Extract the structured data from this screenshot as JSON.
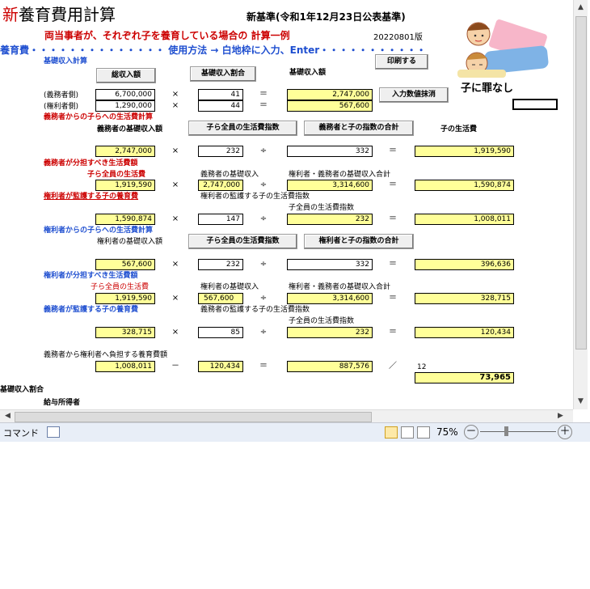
{
  "title": {
    "new": "新",
    "rest": "養育費用計算"
  },
  "standard": "新基準(令和1年12月23日公表基準)",
  "subtitle": "両当事者が、それぞれ子を養育している場合の 計算一例",
  "version": "20220801版",
  "usage": {
    "left": "養育費",
    "dots": "・・・・・・・・・・・・・・",
    "text": "使用方法 → 白地枠に入力、Enter",
    "dots2": "・・・・・・・・・・・"
  },
  "illustration_caption": "子に罪なし",
  "section1": {
    "title": "基礎収入計算",
    "btn_gross": "総収入額",
    "btn_ratio": "基礎収入割合",
    "col_basic": "基礎収入額",
    "btn_print": "印刷する",
    "btn_clear": "入力数値抹消",
    "row_obligor": {
      "label": "(義務者側)",
      "gross": "6,700,000",
      "ratio": "41",
      "basic": "2,747,000"
    },
    "row_obligee": {
      "label": "(権利者側)",
      "gross": "1,290,000",
      "ratio": "44",
      "basic": "567,600"
    }
  },
  "section2": {
    "title": "義務者からの子らへの生活費計算",
    "label_basic": "義務者の基礎収入額",
    "btn_index": "子ら全員の生活費指数",
    "btn_sum": "義務者と子の指数の合計",
    "col_living": "子の生活費",
    "row": {
      "basic": "2,747,000",
      "index": "232",
      "sum": "332",
      "living": "1,919,590"
    }
  },
  "section3": {
    "title": "義務者が分担すべき生活費額",
    "label_child": "子ら全員の生活費",
    "label_obligor_basic": "義務者の基礎収入",
    "label_total": "権利者・義務者の基礎収入合計",
    "row": {
      "child": "1,919,590",
      "basic": "2,747,000",
      "total": "3,314,600",
      "result": "1,590,874"
    }
  },
  "section4": {
    "title": "権利者が監護する子の養育費",
    "label_index": "権利者の監護する子の生活費指数",
    "label_all": "子全員の生活費指数",
    "row": {
      "a": "1,590,874",
      "b": "147",
      "c": "232",
      "result": "1,008,011"
    }
  },
  "section5": {
    "title": "権利者からの子らへの生活費計算",
    "label_basic": "権利者の基礎収入額",
    "btn_index": "子ら全員の生活費指数",
    "btn_sum": "権利者と子の指数の合計",
    "row": {
      "basic": "567,600",
      "index": "232",
      "sum": "332",
      "living": "396,636"
    }
  },
  "section6": {
    "title": "権利者が分担すべき生活費額",
    "label_child": "子ら全員の生活費",
    "label_obligee_basic": "権利者の基礎収入",
    "label_total": "権利者・義務者の基礎収入合計",
    "row": {
      "child": "1,919,590",
      "basic": "567,600",
      "total": "3,314,600",
      "result": "328,715"
    }
  },
  "section7": {
    "title": "義務者が監護する子の養育費",
    "label_index": "義務者の監護する子の生活費指数",
    "label_all": "子全員の生活費指数",
    "row": {
      "a": "328,715",
      "b": "85",
      "c": "232",
      "result": "120,434"
    }
  },
  "section8": {
    "label": "義務者から権利者へ負担する養育費額",
    "row": {
      "a": "1,008,011",
      "b": "120,434",
      "c": "887,576",
      "months": "12",
      "monthly": "73,965"
    }
  },
  "footer_labels": {
    "ratio": "基礎収入割合",
    "salary": "給与所得者"
  },
  "ops": {
    "times": "×",
    "equals": "＝",
    "divide": "÷",
    "minus": "－",
    "slash": "／"
  },
  "statusbar": {
    "mode": "コマンド",
    "zoom": "75%",
    "minus": "－",
    "plus": "＋"
  }
}
